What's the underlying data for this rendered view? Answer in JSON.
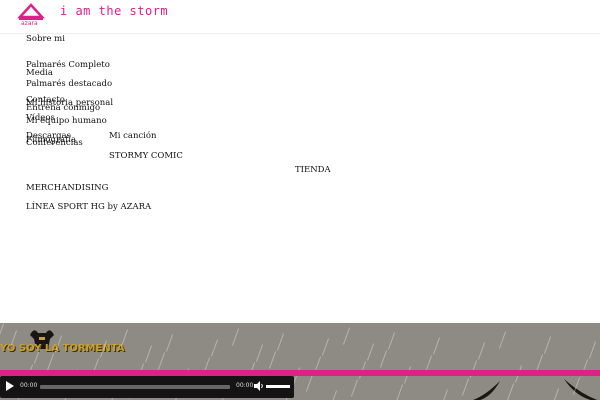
{
  "header": {
    "logo_text": "azara",
    "tagline": "i am the storm",
    "brand_color": "#e0208a"
  },
  "nav": {
    "sobre_mi": "Sobre mi",
    "palmares_completo": "Palmarés Completo",
    "media": "Media",
    "palmares_destacado": "Palmarés destacado",
    "contacto": "Contacto",
    "mi_historia": "Mi historia personal",
    "entrena": "Entrena conmigo",
    "videos": "Vídeos",
    "equipo": "Mi equipo humano",
    "descargas": "Descargas",
    "filmografia": "Filmografía",
    "conferencias": "Conferencias",
    "mi_cancion": "Mi canción",
    "stormy": "STORMY COMIC",
    "tienda": "TIENDA",
    "merch": "MERCHANDISING",
    "linea": "LÍNEA SPORT HG by AZARA"
  },
  "banner": {
    "title": "YO SOY LA TORMENTA"
  },
  "player": {
    "current_time": "00:00",
    "duration": "00:00",
    "progress": 0,
    "volume": 1.0
  }
}
